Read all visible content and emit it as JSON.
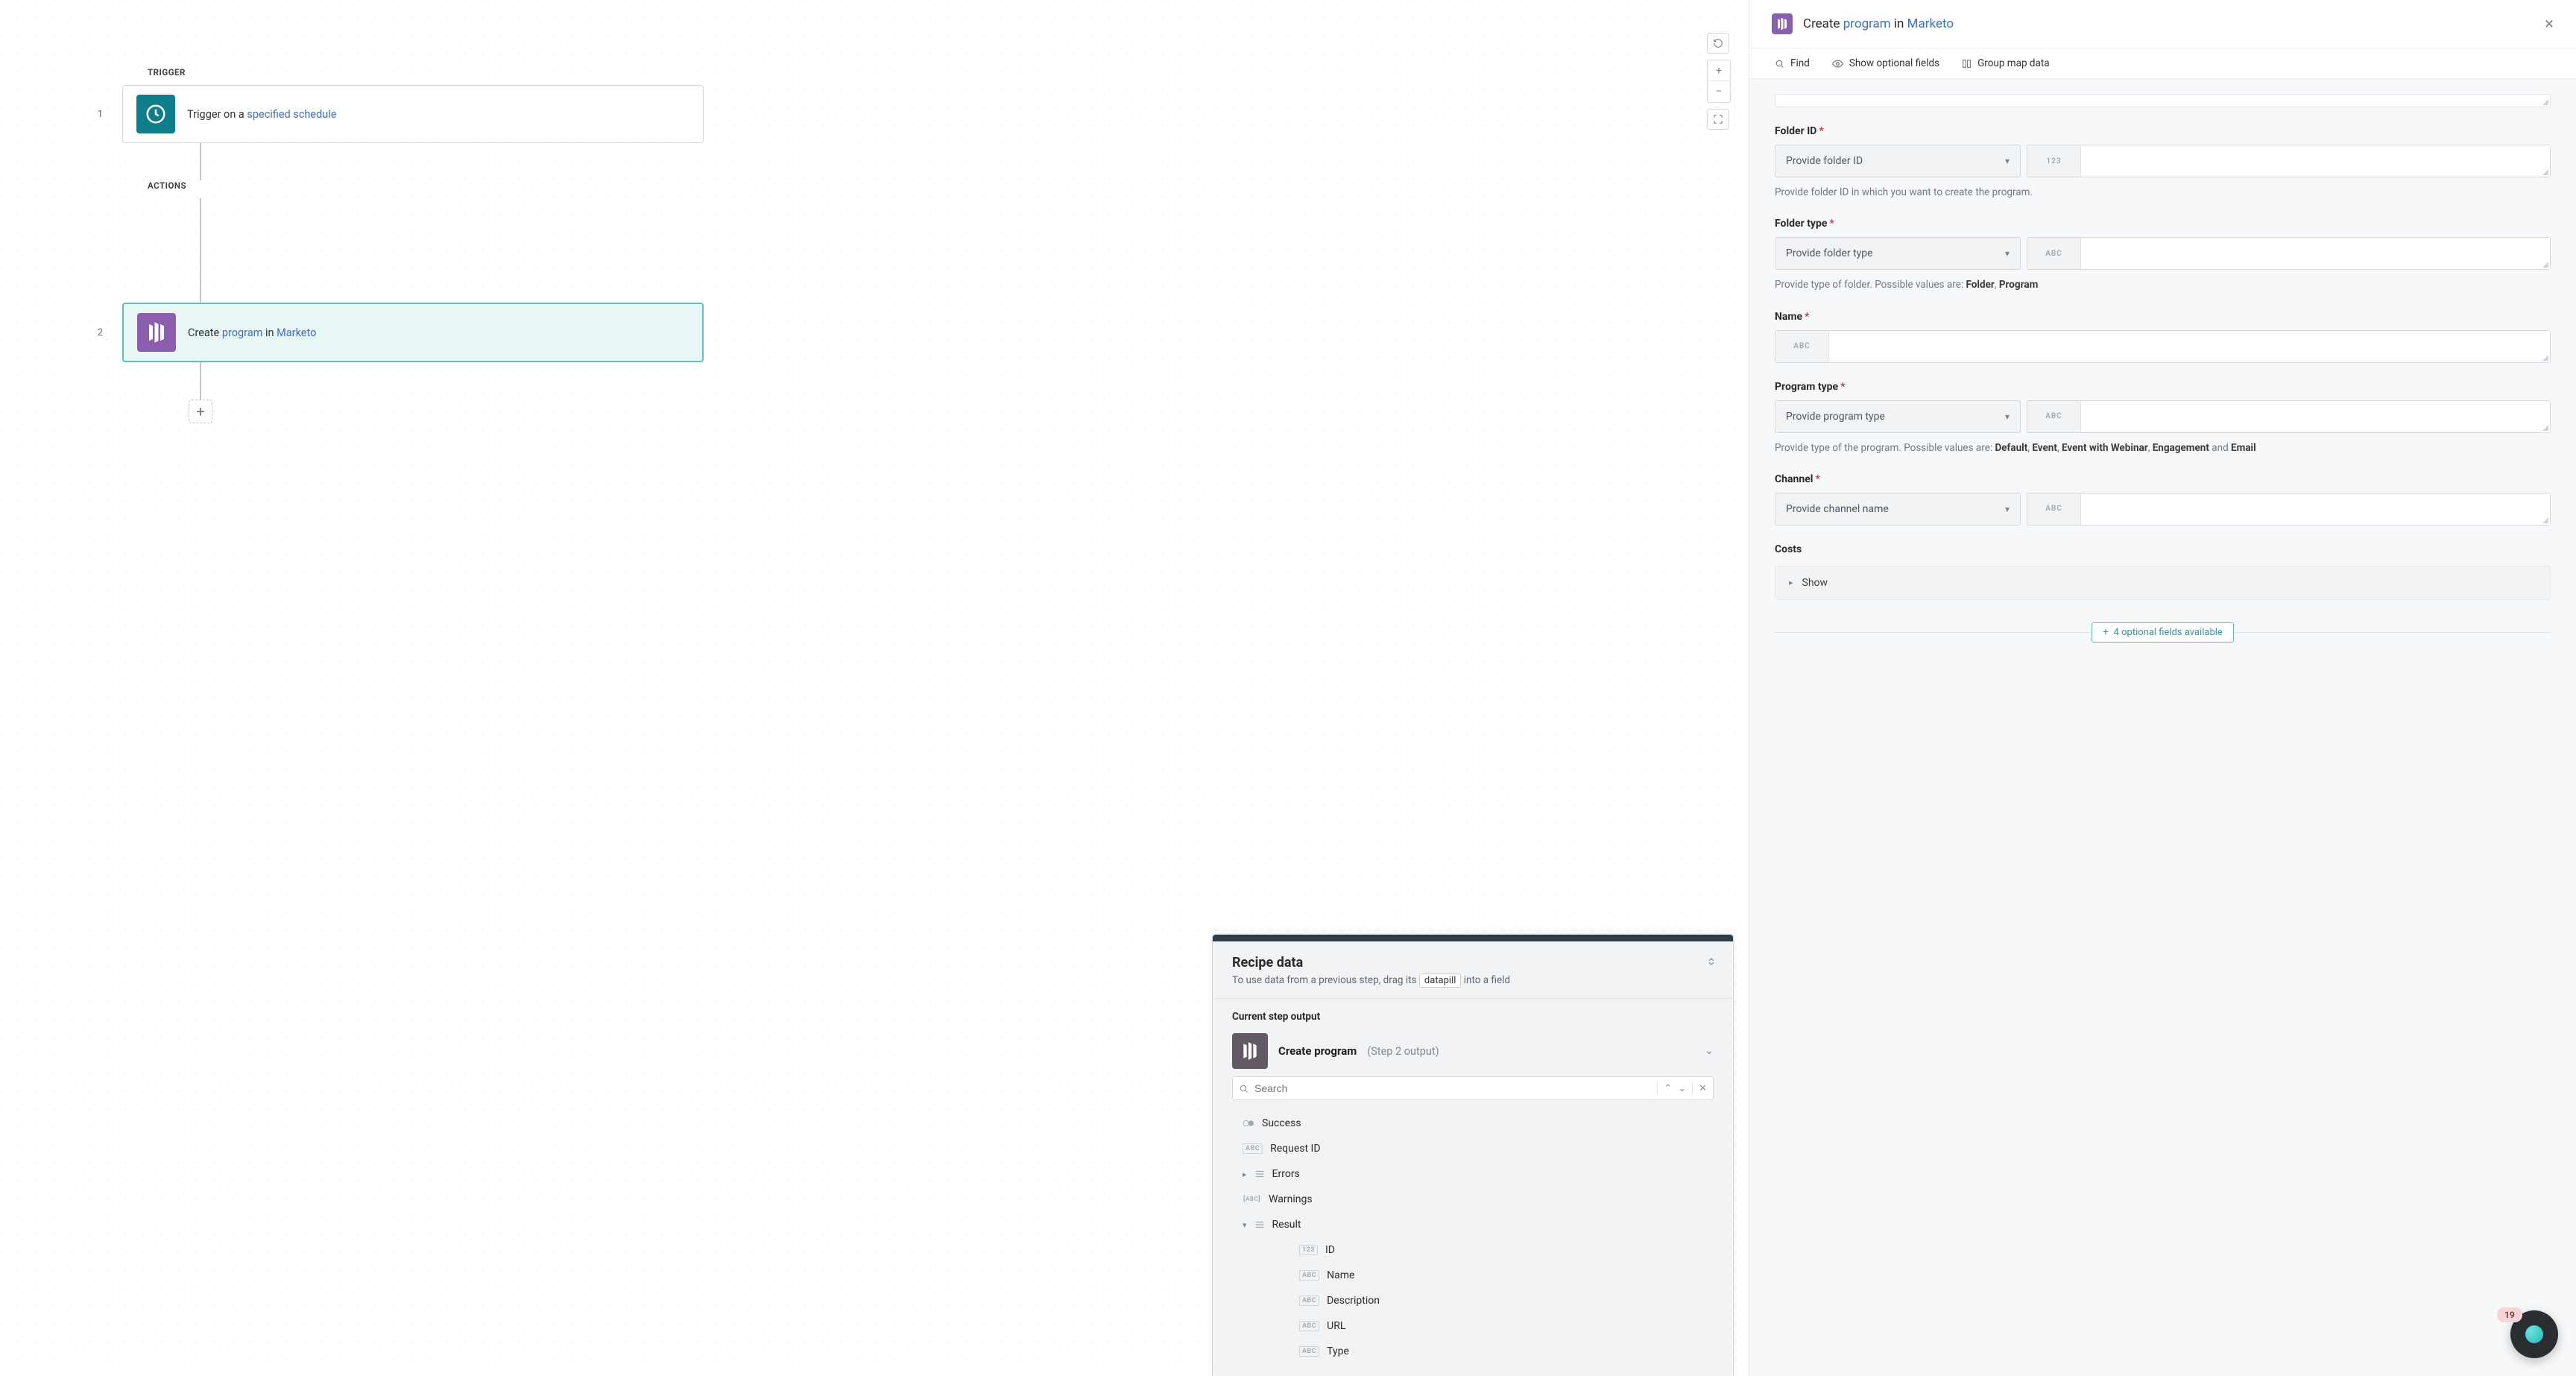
{
  "canvas": {
    "trigger_label": "TRIGGER",
    "actions_label": "ACTIONS",
    "step1_num": "1",
    "step1_prefix": "Trigger on a ",
    "step1_link": "specified schedule",
    "step2_num": "2",
    "step2_prefix": "Create ",
    "step2_link1": "program",
    "step2_mid": " in ",
    "step2_link2": "Marketo",
    "plus": "+"
  },
  "recipe": {
    "title": "Recipe data",
    "sub_prefix": "To use data from a previous step, drag its ",
    "datapill": "datapill",
    "sub_suffix": " into a field",
    "current_label": "Current step output",
    "output_name": "Create program",
    "output_meta": "(Step 2 output)",
    "search_placeholder": "Search",
    "tree": {
      "success": "Success",
      "request_id": "Request ID",
      "errors": "Errors",
      "warnings": "Warnings",
      "result": "Result",
      "id": "ID",
      "name": "Name",
      "description": "Description",
      "url": "URL",
      "type": "Type"
    }
  },
  "config": {
    "title_prefix": "Create ",
    "title_link1": "program",
    "title_mid": " in ",
    "title_link2": "Marketo",
    "toolbar": {
      "find": "Find",
      "show_optional": "Show optional fields",
      "group_map": "Group map data"
    },
    "fields": {
      "folder_id": {
        "label": "Folder ID",
        "select_text": "Provide folder ID",
        "prefix": "123",
        "helper": "Provide folder ID in which you want to create the program."
      },
      "folder_type": {
        "label": "Folder type",
        "select_text": "Provide folder type",
        "prefix": "ABC",
        "helper_prefix": "Provide type of folder. Possible values are: ",
        "v1": "Folder",
        "sep": ", ",
        "v2": "Program"
      },
      "name": {
        "label": "Name",
        "prefix": "ABC"
      },
      "program_type": {
        "label": "Program type",
        "select_text": "Provide program type",
        "prefix": "ABC",
        "helper_prefix": "Provide type of the program. Possible values are: ",
        "v1": "Default",
        "c1": ", ",
        "v2": "Event",
        "c2": ", ",
        "v3": "Event with Webinar",
        "c3": ", ",
        "v4": "Engagement",
        "c4": " and ",
        "v5": "Email"
      },
      "channel": {
        "label": "Channel",
        "select_text": "Provide channel name",
        "prefix": "ABC"
      },
      "costs": {
        "label": "Costs",
        "show": "Show"
      }
    },
    "optional_pill": "4 optional fields available"
  },
  "help_count": "19"
}
